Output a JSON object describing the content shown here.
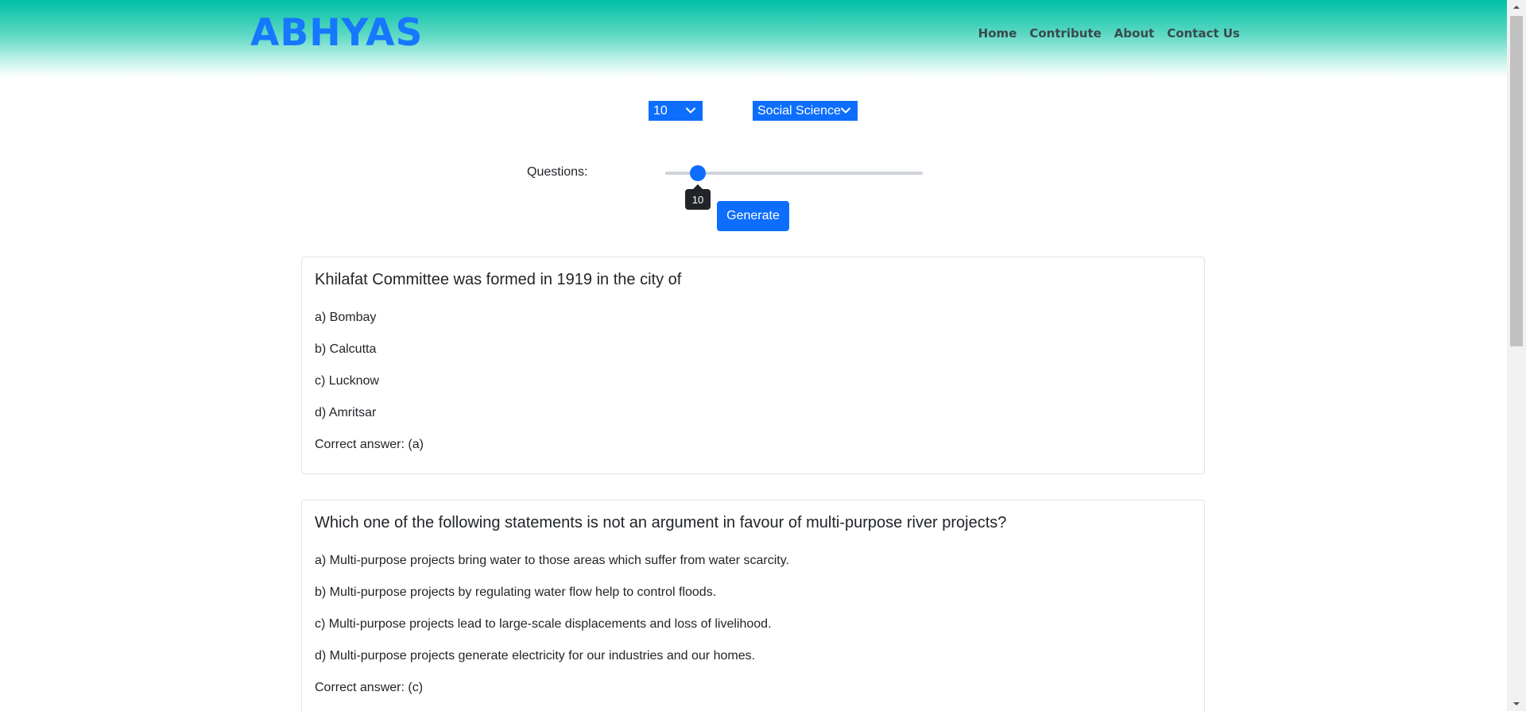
{
  "brand": {
    "name": "ABHYAS",
    "color": "#1677ff"
  },
  "nav": {
    "items": [
      "Home",
      "Contribute",
      "About",
      "Contact Us"
    ]
  },
  "filters": {
    "grade": {
      "selected": "10"
    },
    "subject": {
      "selected": "Social Science"
    }
  },
  "slider": {
    "label": "Questions:",
    "value": "10",
    "fraction": 0.125
  },
  "generate_label": "Generate",
  "questions": [
    {
      "question": "Khilafat Committee was formed in 1919 in the city of",
      "options": [
        "a) Bombay",
        "b) Calcutta",
        "c) Lucknow",
        "d) Amritsar"
      ],
      "answer": "Correct answer: (a)"
    },
    {
      "question": "Which one of the following statements is not an argument in favour of multi-purpose river projects?",
      "options": [
        "a) Multi-purpose projects bring water to those areas which suffer from water scarcity.",
        "b) Multi-purpose projects by regulating water flow help to control floods.",
        "c) Multi-purpose projects lead to large-scale displacements and loss of livelihood.",
        "d) Multi-purpose projects generate electricity for our industries and our homes."
      ],
      "answer": "Correct answer: (c)"
    }
  ],
  "colors": {
    "accent": "#0d6efd",
    "header_top": "#00bfa5"
  }
}
